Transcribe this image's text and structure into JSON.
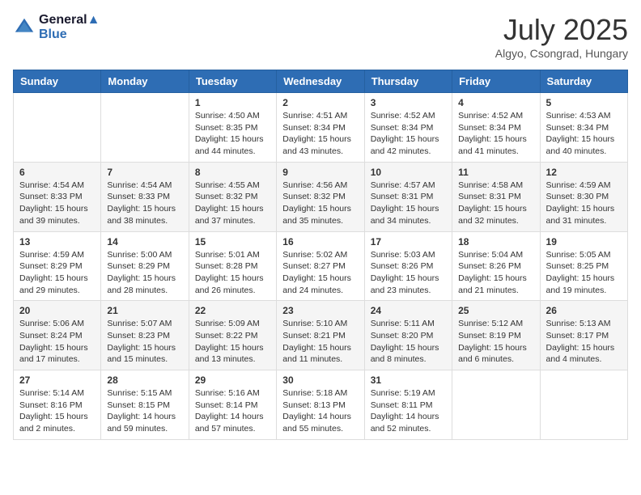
{
  "header": {
    "logo_line1": "General",
    "logo_line2": "Blue",
    "month_year": "July 2025",
    "location": "Algyo, Csongrad, Hungary"
  },
  "weekdays": [
    "Sunday",
    "Monday",
    "Tuesday",
    "Wednesday",
    "Thursday",
    "Friday",
    "Saturday"
  ],
  "weeks": [
    [
      {
        "day": "",
        "info": ""
      },
      {
        "day": "",
        "info": ""
      },
      {
        "day": "1",
        "info": "Sunrise: 4:50 AM\nSunset: 8:35 PM\nDaylight: 15 hours and 44 minutes."
      },
      {
        "day": "2",
        "info": "Sunrise: 4:51 AM\nSunset: 8:34 PM\nDaylight: 15 hours and 43 minutes."
      },
      {
        "day": "3",
        "info": "Sunrise: 4:52 AM\nSunset: 8:34 PM\nDaylight: 15 hours and 42 minutes."
      },
      {
        "day": "4",
        "info": "Sunrise: 4:52 AM\nSunset: 8:34 PM\nDaylight: 15 hours and 41 minutes."
      },
      {
        "day": "5",
        "info": "Sunrise: 4:53 AM\nSunset: 8:34 PM\nDaylight: 15 hours and 40 minutes."
      }
    ],
    [
      {
        "day": "6",
        "info": "Sunrise: 4:54 AM\nSunset: 8:33 PM\nDaylight: 15 hours and 39 minutes."
      },
      {
        "day": "7",
        "info": "Sunrise: 4:54 AM\nSunset: 8:33 PM\nDaylight: 15 hours and 38 minutes."
      },
      {
        "day": "8",
        "info": "Sunrise: 4:55 AM\nSunset: 8:32 PM\nDaylight: 15 hours and 37 minutes."
      },
      {
        "day": "9",
        "info": "Sunrise: 4:56 AM\nSunset: 8:32 PM\nDaylight: 15 hours and 35 minutes."
      },
      {
        "day": "10",
        "info": "Sunrise: 4:57 AM\nSunset: 8:31 PM\nDaylight: 15 hours and 34 minutes."
      },
      {
        "day": "11",
        "info": "Sunrise: 4:58 AM\nSunset: 8:31 PM\nDaylight: 15 hours and 32 minutes."
      },
      {
        "day": "12",
        "info": "Sunrise: 4:59 AM\nSunset: 8:30 PM\nDaylight: 15 hours and 31 minutes."
      }
    ],
    [
      {
        "day": "13",
        "info": "Sunrise: 4:59 AM\nSunset: 8:29 PM\nDaylight: 15 hours and 29 minutes."
      },
      {
        "day": "14",
        "info": "Sunrise: 5:00 AM\nSunset: 8:29 PM\nDaylight: 15 hours and 28 minutes."
      },
      {
        "day": "15",
        "info": "Sunrise: 5:01 AM\nSunset: 8:28 PM\nDaylight: 15 hours and 26 minutes."
      },
      {
        "day": "16",
        "info": "Sunrise: 5:02 AM\nSunset: 8:27 PM\nDaylight: 15 hours and 24 minutes."
      },
      {
        "day": "17",
        "info": "Sunrise: 5:03 AM\nSunset: 8:26 PM\nDaylight: 15 hours and 23 minutes."
      },
      {
        "day": "18",
        "info": "Sunrise: 5:04 AM\nSunset: 8:26 PM\nDaylight: 15 hours and 21 minutes."
      },
      {
        "day": "19",
        "info": "Sunrise: 5:05 AM\nSunset: 8:25 PM\nDaylight: 15 hours and 19 minutes."
      }
    ],
    [
      {
        "day": "20",
        "info": "Sunrise: 5:06 AM\nSunset: 8:24 PM\nDaylight: 15 hours and 17 minutes."
      },
      {
        "day": "21",
        "info": "Sunrise: 5:07 AM\nSunset: 8:23 PM\nDaylight: 15 hours and 15 minutes."
      },
      {
        "day": "22",
        "info": "Sunrise: 5:09 AM\nSunset: 8:22 PM\nDaylight: 15 hours and 13 minutes."
      },
      {
        "day": "23",
        "info": "Sunrise: 5:10 AM\nSunset: 8:21 PM\nDaylight: 15 hours and 11 minutes."
      },
      {
        "day": "24",
        "info": "Sunrise: 5:11 AM\nSunset: 8:20 PM\nDaylight: 15 hours and 8 minutes."
      },
      {
        "day": "25",
        "info": "Sunrise: 5:12 AM\nSunset: 8:19 PM\nDaylight: 15 hours and 6 minutes."
      },
      {
        "day": "26",
        "info": "Sunrise: 5:13 AM\nSunset: 8:17 PM\nDaylight: 15 hours and 4 minutes."
      }
    ],
    [
      {
        "day": "27",
        "info": "Sunrise: 5:14 AM\nSunset: 8:16 PM\nDaylight: 15 hours and 2 minutes."
      },
      {
        "day": "28",
        "info": "Sunrise: 5:15 AM\nSunset: 8:15 PM\nDaylight: 14 hours and 59 minutes."
      },
      {
        "day": "29",
        "info": "Sunrise: 5:16 AM\nSunset: 8:14 PM\nDaylight: 14 hours and 57 minutes."
      },
      {
        "day": "30",
        "info": "Sunrise: 5:18 AM\nSunset: 8:13 PM\nDaylight: 14 hours and 55 minutes."
      },
      {
        "day": "31",
        "info": "Sunrise: 5:19 AM\nSunset: 8:11 PM\nDaylight: 14 hours and 52 minutes."
      },
      {
        "day": "",
        "info": ""
      },
      {
        "day": "",
        "info": ""
      }
    ]
  ]
}
